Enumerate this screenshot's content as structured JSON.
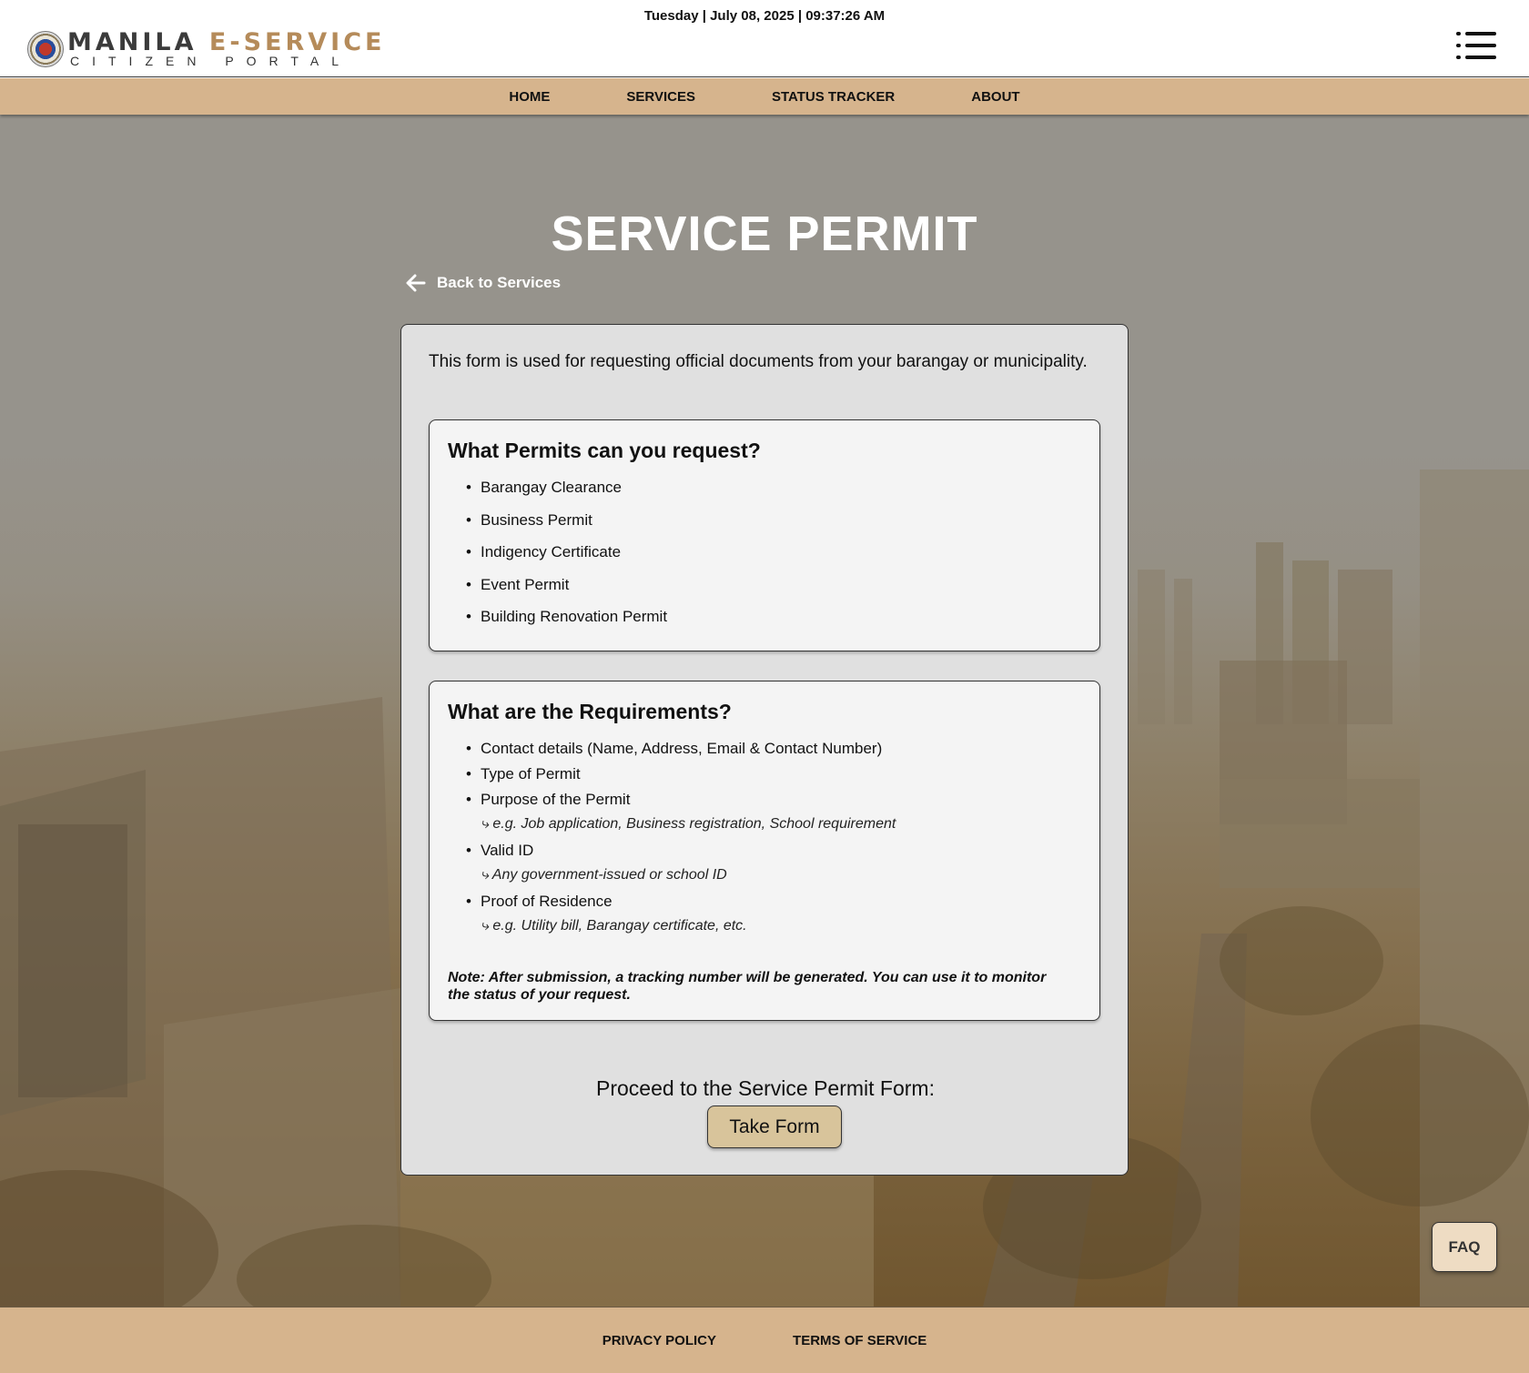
{
  "header": {
    "datetime": "Tuesday | July 08, 2025 | 09:37:26 AM",
    "logo_title_main": "MANILA ",
    "logo_title_accent": "E-SERVICE",
    "logo_subtitle": "CITIZEN PORTAL"
  },
  "nav": {
    "items": [
      "HOME",
      "SERVICES",
      "STATUS TRACKER",
      "ABOUT"
    ]
  },
  "page": {
    "title": "SERVICE PERMIT",
    "back_label": "Back to Services",
    "intro": "This form is used for requesting official documents from your barangay or municipality."
  },
  "permits": {
    "heading": "What Permits can you request?",
    "items": [
      "Barangay Clearance",
      "Business Permit",
      "Indigency Certificate",
      "Event Permit",
      "Building Renovation Permit"
    ]
  },
  "requirements": {
    "heading": "What are the Requirements?",
    "items": [
      "Contact details (Name, Address, Email & Contact Number)",
      "Type of Permit",
      "Purpose of the Permit",
      "Valid ID",
      "Proof of Residence"
    ],
    "subs": [
      "⤷ e.g. Job application, Business registration, School requirement",
      "⤷ Any government-issued or school ID",
      "⤷ e.g. Utility bill, Barangay certificate, etc."
    ],
    "note": "Note: After submission, a tracking number will be generated. You can use it to monitor the status of your request."
  },
  "cta": {
    "prompt": "Proceed to the Service Permit Form:",
    "button": "Take Form"
  },
  "faq_label": "FAQ",
  "footer": {
    "links": [
      "PRIVACY POLICY",
      "TERMS OF SERVICE"
    ]
  },
  "colors": {
    "nav_bg": "#d6b48d",
    "accent": "#b58b5a",
    "button_bg": "#d8c49b"
  },
  "icons": {
    "menu": "menu-list-icon",
    "back": "arrow-left-icon",
    "seal": "city-seal-icon"
  }
}
